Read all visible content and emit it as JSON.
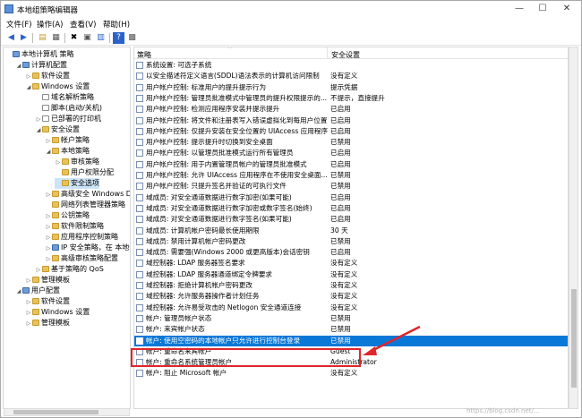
{
  "window": {
    "title": "本地组策略编辑器",
    "min": "—",
    "max": "☐",
    "close": "✕"
  },
  "menu": [
    "文件(F)",
    "操作(A)",
    "查看(V)",
    "帮助(H)"
  ],
  "tree": {
    "items": [
      {
        "label": "本地计算机 策略",
        "indent": 0,
        "toggle": "",
        "icon": "pc"
      },
      {
        "label": "计算机配置",
        "indent": 1,
        "toggle": "◢",
        "icon": "pc"
      },
      {
        "label": "软件设置",
        "indent": 2,
        "toggle": "▷",
        "icon": "fld"
      },
      {
        "label": "Windows 设置",
        "indent": 2,
        "toggle": "◢",
        "icon": "fld"
      },
      {
        "label": "域名解析策略",
        "indent": 3,
        "toggle": "",
        "icon": "doc"
      },
      {
        "label": "脚本(启动/关机)",
        "indent": 3,
        "toggle": "",
        "icon": "doc"
      },
      {
        "label": "已部署的打印机",
        "indent": 3,
        "toggle": "▷",
        "icon": "doc"
      },
      {
        "label": "安全设置",
        "indent": 3,
        "toggle": "◢",
        "icon": "fld"
      },
      {
        "label": "帐户策略",
        "indent": 4,
        "toggle": "▷",
        "icon": "fld"
      },
      {
        "label": "本地策略",
        "indent": 4,
        "toggle": "◢",
        "icon": "fld"
      },
      {
        "label": "审核策略",
        "indent": 5,
        "toggle": "▷",
        "icon": "fld"
      },
      {
        "label": "用户权限分配",
        "indent": 5,
        "toggle": "",
        "icon": "fld"
      },
      {
        "label": "安全选项",
        "indent": 5,
        "toggle": "",
        "icon": "fld",
        "selected": true
      },
      {
        "label": "高级安全 Windows De",
        "indent": 4,
        "toggle": "▷",
        "icon": "fld"
      },
      {
        "label": "网络列表管理器策略",
        "indent": 4,
        "toggle": "",
        "icon": "fld"
      },
      {
        "label": "公钥策略",
        "indent": 4,
        "toggle": "▷",
        "icon": "fld"
      },
      {
        "label": "软件限制策略",
        "indent": 4,
        "toggle": "▷",
        "icon": "fld"
      },
      {
        "label": "应用程序控制策略",
        "indent": 4,
        "toggle": "▷",
        "icon": "fld"
      },
      {
        "label": "IP 安全策略，在 本地计",
        "indent": 4,
        "toggle": "▷",
        "icon": "pc"
      },
      {
        "label": "高级审核策略配置",
        "indent": 4,
        "toggle": "▷",
        "icon": "fld"
      },
      {
        "label": "基于策略的 QoS",
        "indent": 3,
        "toggle": "▷",
        "icon": "fld"
      },
      {
        "label": "管理模板",
        "indent": 2,
        "toggle": "▷",
        "icon": "fld"
      },
      {
        "label": "用户配置",
        "indent": 1,
        "toggle": "◢",
        "icon": "pc"
      },
      {
        "label": "软件设置",
        "indent": 2,
        "toggle": "▷",
        "icon": "fld"
      },
      {
        "label": "Windows 设置",
        "indent": 2,
        "toggle": "▷",
        "icon": "fld"
      },
      {
        "label": "管理模板",
        "indent": 2,
        "toggle": "▷",
        "icon": "fld"
      }
    ]
  },
  "list": {
    "header": {
      "name": "策略",
      "setting": "安全设置"
    },
    "rows": [
      {
        "name": "系统设置: 可选子系统",
        "setting": ""
      },
      {
        "name": "以安全描述符定义语言(SDDL)语法表示的计算机访问限制",
        "setting": "没有定义"
      },
      {
        "name": "用户帐户控制: 标准用户的提升提示行为",
        "setting": "提示凭据"
      },
      {
        "name": "用户帐户控制: 管理员批准模式中管理员的提升权限提示的...",
        "setting": "不提示，直接提升"
      },
      {
        "name": "用户帐户控制: 检测应用程序安装并提示提升",
        "setting": "已启用"
      },
      {
        "name": "用户帐户控制: 将文件和注册表写入错误虚拟化到每用户位置",
        "setting": "已启用"
      },
      {
        "name": "用户帐户控制: 仅提升安装在安全位置的 UIAccess 应用程序",
        "setting": "已启用"
      },
      {
        "name": "用户帐户控制: 提示提升时切换到安全桌面",
        "setting": "已禁用"
      },
      {
        "name": "用户帐户控制: 以管理员批准模式运行所有管理员",
        "setting": "已启用"
      },
      {
        "name": "用户帐户控制: 用于内置管理员帐户的管理员批准模式",
        "setting": "已启用"
      },
      {
        "name": "用户帐户控制: 允许 UIAccess 应用程序在不使用安全桌面...",
        "setting": "已禁用"
      },
      {
        "name": "用户帐户控制: 只提升签名并验证的可执行文件",
        "setting": "已禁用"
      },
      {
        "name": "域成员: 对安全通道数据进行数字加密(如果可能)",
        "setting": "已启用"
      },
      {
        "name": "域成员: 对安全通道数据进行数字加密或数字签名(始终)",
        "setting": "已启用"
      },
      {
        "name": "域成员: 对安全通道数据进行数字签名(如果可能)",
        "setting": "已启用"
      },
      {
        "name": "域成员: 计算机帐户密码最长使用期限",
        "setting": "30 天"
      },
      {
        "name": "域成员: 禁用计算机帐户密码更改",
        "setting": "已禁用"
      },
      {
        "name": "域成员: 需要强(Windows 2000 或更高版本)会话密钥",
        "setting": "已启用"
      },
      {
        "name": "域控制器: LDAP 服务器签名要求",
        "setting": "没有定义"
      },
      {
        "name": "域控制器: LDAP 服务器通道绑定令牌要求",
        "setting": "没有定义"
      },
      {
        "name": "域控制器: 拒绝计算机帐户密码更改",
        "setting": "没有定义"
      },
      {
        "name": "域控制器: 允许服务器操作者计划任务",
        "setting": "没有定义"
      },
      {
        "name": "域控制器: 允许易受攻击的 Netlogon 安全通道连接",
        "setting": "没有定义"
      },
      {
        "name": "帐户: 管理员帐户状态",
        "setting": "已禁用"
      },
      {
        "name": "帐户: 来宾帐户状态",
        "setting": "已禁用"
      },
      {
        "name": "帐户: 使用空密码的本地帐户只允许进行控制台登录",
        "setting": "已禁用",
        "highlight": true
      },
      {
        "name": "帐户: 重命名来宾帐户",
        "setting": "Guest"
      },
      {
        "name": "帐户: 重命名系统管理员帐户",
        "setting": "Administrator"
      },
      {
        "name": "帐户: 阻止 Microsoft 帐户",
        "setting": "没有定义"
      }
    ]
  },
  "watermark": "https://blog.csdn.net/..."
}
